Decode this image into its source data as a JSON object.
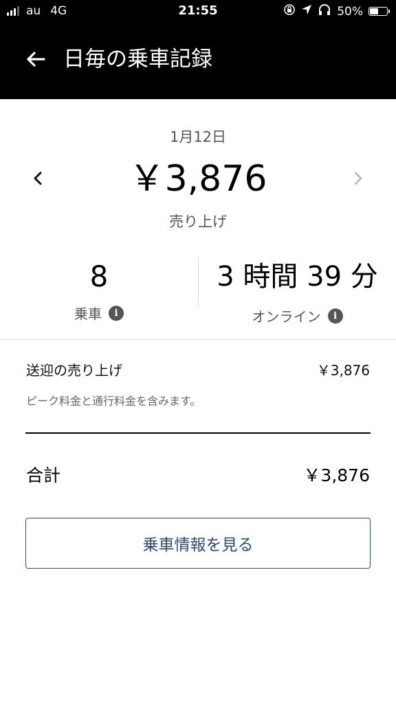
{
  "status_bar": {
    "carrier": "au",
    "network": "4G",
    "time": "21:55",
    "battery": "50%",
    "battery_level": 0.5
  },
  "header": {
    "title": "日毎の乗車記録"
  },
  "summary": {
    "date": "1月12日",
    "amount": "￥3,876",
    "amount_label": "売り上げ"
  },
  "stats": {
    "rides_value": "8",
    "rides_label": "乗車",
    "online_value": "3 時間 39 分",
    "online_label": "オンライン"
  },
  "breakdown": {
    "item_label": "送迎の売り上げ",
    "item_value": "￥3,876",
    "item_note": "ピーク料金と通行料金を含みます。",
    "total_label": "合計",
    "total_value": "￥3,876"
  },
  "actions": {
    "trip_details_label": "乗車情報を見る"
  },
  "icons": {
    "back": "arrow-left-icon",
    "prev": "chevron-left-icon",
    "next": "chevron-right-icon",
    "info": "info-icon",
    "location": "location-arrow-icon",
    "headphones": "headphones-icon",
    "orientation_lock": "orientation-lock-icon"
  },
  "colors": {
    "header_bg": "#000000",
    "button_accent": "#2e4a7a",
    "muted_text": "#555555"
  }
}
